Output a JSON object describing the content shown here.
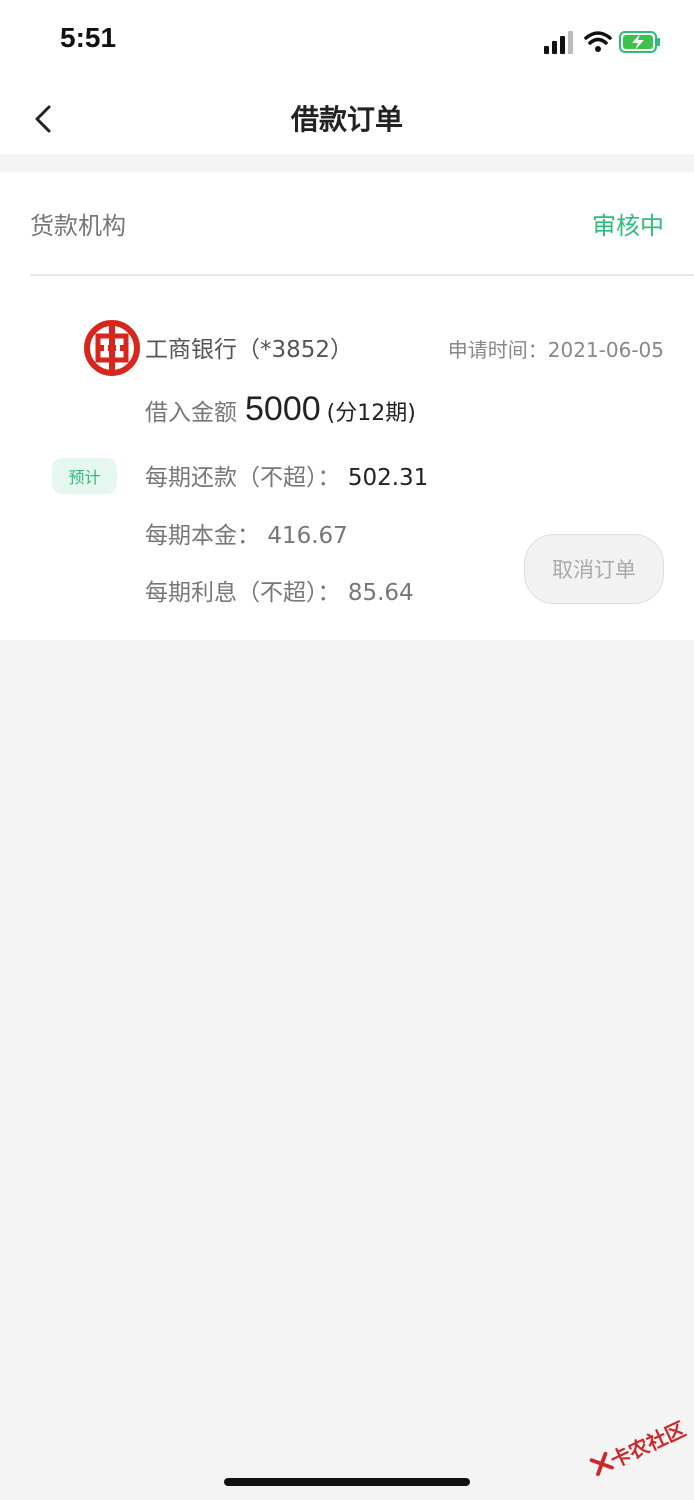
{
  "status_bar": {
    "time": "5:51",
    "icons": [
      "signal-icon",
      "wifi-icon",
      "battery-charging-icon"
    ]
  },
  "nav": {
    "title": "借款订单",
    "back_icon": "chevron-left-icon"
  },
  "card": {
    "institution_label": "货款机构",
    "status": "审核中",
    "bank_name": "工商银行（*3852）",
    "apply_time": "申请时间：2021-06-05",
    "amount_label": "借入金额",
    "amount_value": "5000",
    "amount_term": "(分12期)",
    "estimate_badge": "预计",
    "repayment_label": "每期还款（不超）：",
    "repayment_value": "502.31",
    "principal_label": "每期本金：",
    "principal_value": "416.67",
    "interest_label": "每期利息（不超）：",
    "interest_value": "85.64",
    "cancel_button": "取消订单"
  },
  "watermark": {
    "text": "卡农社区"
  },
  "colors": {
    "accent": "#2dbd7a",
    "bank_red": "#d7261e",
    "background": "#f4f4f4"
  }
}
